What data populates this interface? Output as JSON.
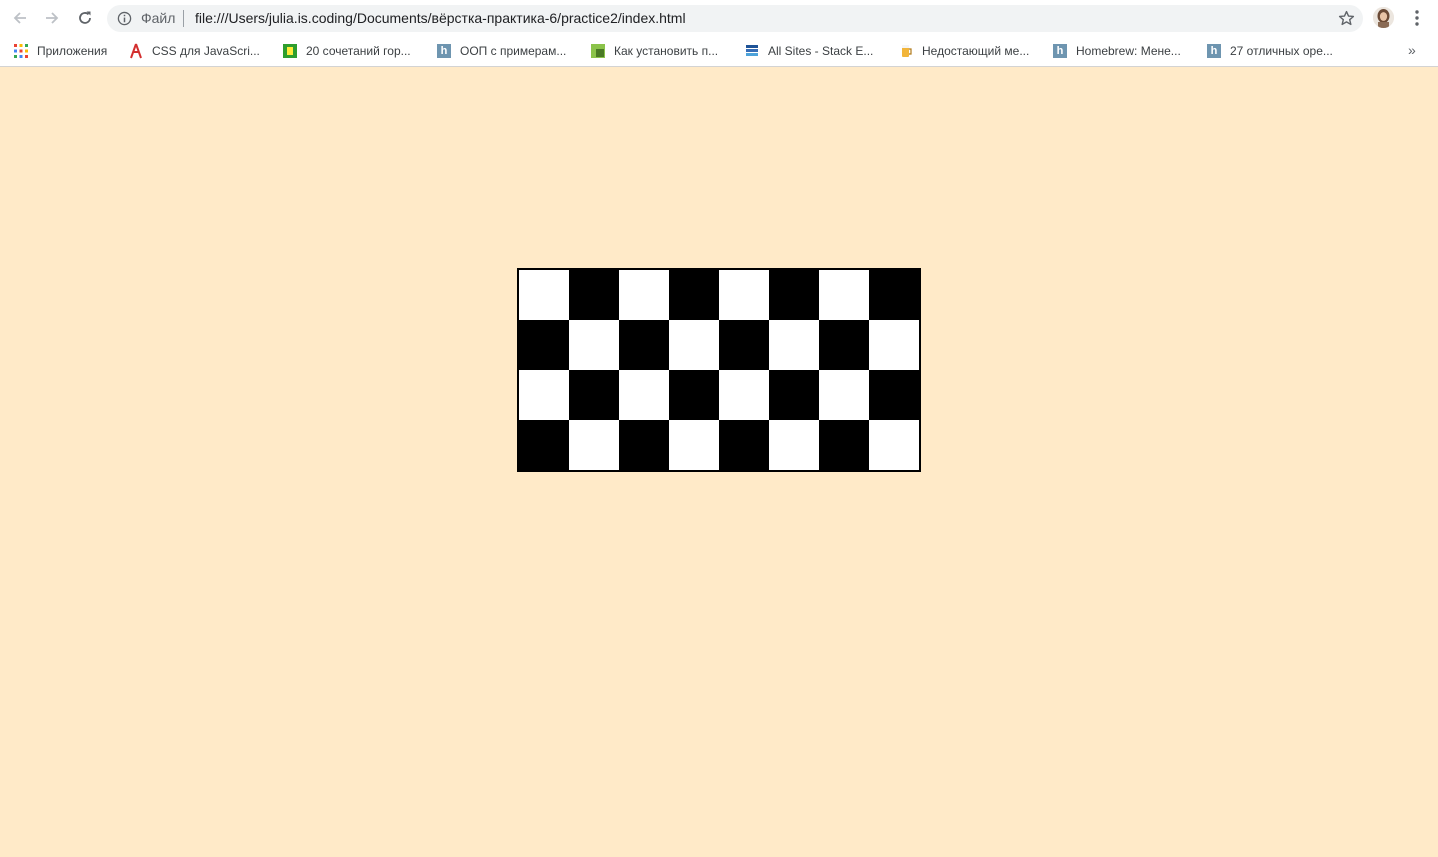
{
  "browser": {
    "scheme_label": "Файл",
    "url": "file:///Users/julia.is.coding/Documents/вёрстка-практика-6/practice2/index.html"
  },
  "bookmarks": [
    {
      "label": "Приложения",
      "icon": "apps-grid-icon"
    },
    {
      "label": "CSS для JavaScri...",
      "icon": "red-figure-icon"
    },
    {
      "label": "20 сочетаний гор...",
      "icon": "green-tag-icon"
    },
    {
      "label": "ООП с примерам...",
      "icon": "habr-h-icon"
    },
    {
      "label": "Как установить п...",
      "icon": "green-book-icon"
    },
    {
      "label": "All Sites - Stack E...",
      "icon": "stack-exchange-icon"
    },
    {
      "label": "Недостающий ме...",
      "icon": "beer-mug-icon"
    },
    {
      "label": "Homebrew: Мене...",
      "icon": "habr-h-icon"
    },
    {
      "label": "27 отличных оре...",
      "icon": "habr-h-icon"
    }
  ],
  "page": {
    "background": "#ffeac8"
  },
  "checkerboard": {
    "rows": 4,
    "cols": 8,
    "dark_color": "#000000",
    "light_color": "#ffffff",
    "first_cell": "light"
  }
}
